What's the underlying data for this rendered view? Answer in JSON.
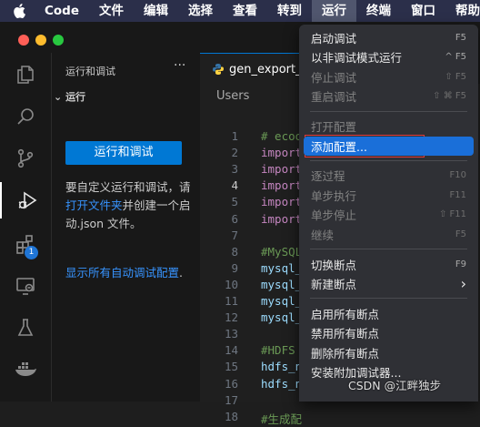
{
  "menubar": {
    "app": "Code",
    "items": [
      "文件",
      "编辑",
      "选择",
      "查看",
      "转到",
      "运行",
      "终端",
      "窗口",
      "帮助"
    ],
    "active": "运行"
  },
  "sidebar": {
    "title": "运行和调试",
    "more": "···",
    "section": "运行",
    "run_button": "运行和调试",
    "text_before": "要自定义运行和调试，请",
    "link_open_folder": "打开文件夹",
    "text_after": "并创建一个启动.json 文件。",
    "link_show_all": "显示所有自动调试配置",
    "link_show_all_suffix": "."
  },
  "activity_badge": "1",
  "editor": {
    "tab_label": "gen_export_",
    "breadcrumb": "Users",
    "lines": [
      {
        "n": "1",
        "text": "# ecoo",
        "kind": "comment"
      },
      {
        "n": "2",
        "text": "import",
        "kind": "kw"
      },
      {
        "n": "3",
        "text": "import",
        "kind": "kw"
      },
      {
        "n": "4",
        "text": "import",
        "kind": "kw"
      },
      {
        "n": "5",
        "text": "import",
        "kind": "kw"
      },
      {
        "n": "6",
        "text": "import",
        "kind": "kw"
      },
      {
        "n": "7",
        "text": "",
        "kind": "plain"
      },
      {
        "n": "8",
        "text": "#MySQL",
        "kind": "comment"
      },
      {
        "n": "9",
        "text": "mysql_",
        "kind": "var"
      },
      {
        "n": "10",
        "text": "mysql_",
        "kind": "var"
      },
      {
        "n": "11",
        "text": "mysql_",
        "kind": "var"
      },
      {
        "n": "12",
        "text": "mysql_",
        "kind": "var"
      },
      {
        "n": "13",
        "text": "",
        "kind": "plain"
      },
      {
        "n": "14",
        "text": "#HDFS",
        "kind": "comment"
      },
      {
        "n": "15",
        "text": "hdfs_n",
        "kind": "var"
      },
      {
        "n": "16",
        "text": "hdfs_n",
        "kind": "var"
      },
      {
        "n": "17",
        "text": "",
        "kind": "plain"
      },
      {
        "n": "18",
        "text": "#生成配",
        "kind": "comment"
      }
    ],
    "current_line": "4"
  },
  "run_menu": {
    "items": [
      {
        "label": "启动调试",
        "shortcut": "F5",
        "disabled": false
      },
      {
        "label": "以非调试模式运行",
        "shortcut": "^ F5",
        "disabled": false
      },
      {
        "label": "停止调试",
        "shortcut": "⇧ F5",
        "disabled": true
      },
      {
        "label": "重启调试",
        "shortcut": "⇧ ⌘ F5",
        "disabled": true
      },
      {
        "label": "打开配置",
        "shortcut": "",
        "disabled": true
      },
      {
        "label": "添加配置...",
        "shortcut": "",
        "disabled": false,
        "highlighted": true
      },
      {
        "label": "逐过程",
        "shortcut": "F10",
        "disabled": true
      },
      {
        "label": "单步执行",
        "shortcut": "F11",
        "disabled": true
      },
      {
        "label": "单步停止",
        "shortcut": "⇧ F11",
        "disabled": true
      },
      {
        "label": "继续",
        "shortcut": "F5",
        "disabled": true
      },
      {
        "label": "切换断点",
        "shortcut": "F9",
        "disabled": false
      },
      {
        "label": "新建断点",
        "shortcut": "›",
        "disabled": false
      },
      {
        "label": "启用所有断点",
        "shortcut": "",
        "disabled": false
      },
      {
        "label": "禁用所有断点",
        "shortcut": "",
        "disabled": false
      },
      {
        "label": "删除所有断点",
        "shortcut": "",
        "disabled": false
      },
      {
        "label": "安装附加调试器...",
        "shortcut": "",
        "disabled": false
      }
    ]
  },
  "watermark": "CSDN @江畔独步",
  "colors": {
    "accent": "#0078d4",
    "menu_highlight": "#1a6fd9",
    "annotation_red": "#e03b3b",
    "link": "#3794ff",
    "keyword": "#c586c0",
    "comment": "#6a9955",
    "variable": "#9cdcfe"
  }
}
